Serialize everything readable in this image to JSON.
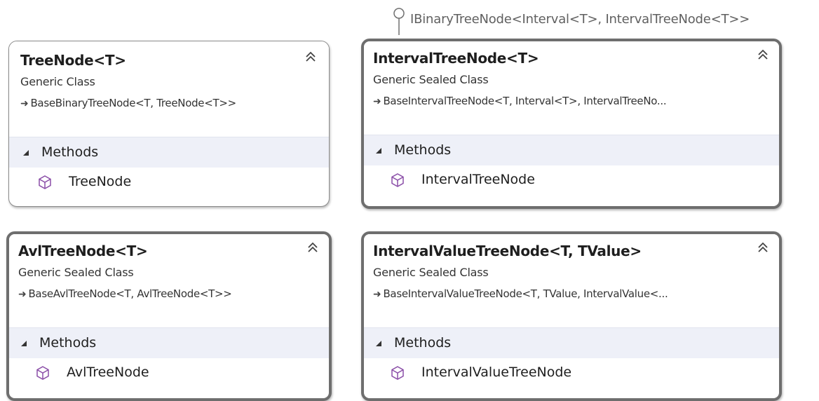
{
  "interface": {
    "label": "IBinaryTreeNode<Interval<T>, IntervalTreeNode<T>>",
    "icon": "lollipop-interface-icon"
  },
  "classes": [
    {
      "title": "TreeNode<T>",
      "kind": "Generic Class",
      "base": "BaseBinaryTreeNode<T, TreeNode<T>>",
      "section": "Methods",
      "members": [
        "TreeNode"
      ],
      "selected": false
    },
    {
      "title": "IntervalTreeNode<T>",
      "kind": "Generic Sealed Class",
      "base": "BaseIntervalTreeNode<T, Interval<T>, IntervalTreeNo...",
      "section": "Methods",
      "members": [
        "IntervalTreeNode"
      ],
      "selected": true
    },
    {
      "title": "AvlTreeNode<T>",
      "kind": "Generic Sealed Class",
      "base": "BaseAvlTreeNode<T, AvlTreeNode<T>>",
      "section": "Methods",
      "members": [
        "AvlTreeNode"
      ],
      "selected": true
    },
    {
      "title": "IntervalValueTreeNode<T, TValue>",
      "kind": "Generic Sealed Class",
      "base": "BaseIntervalValueTreeNode<T, TValue, IntervalValue<...",
      "section": "Methods",
      "members": [
        "IntervalValueTreeNode"
      ],
      "selected": true
    }
  ],
  "colors": {
    "section_bg": "#eef0f8",
    "border_selected": "#6e6e6e",
    "border_normal": "#8c8c8c",
    "method_icon": "#9b59b6"
  }
}
